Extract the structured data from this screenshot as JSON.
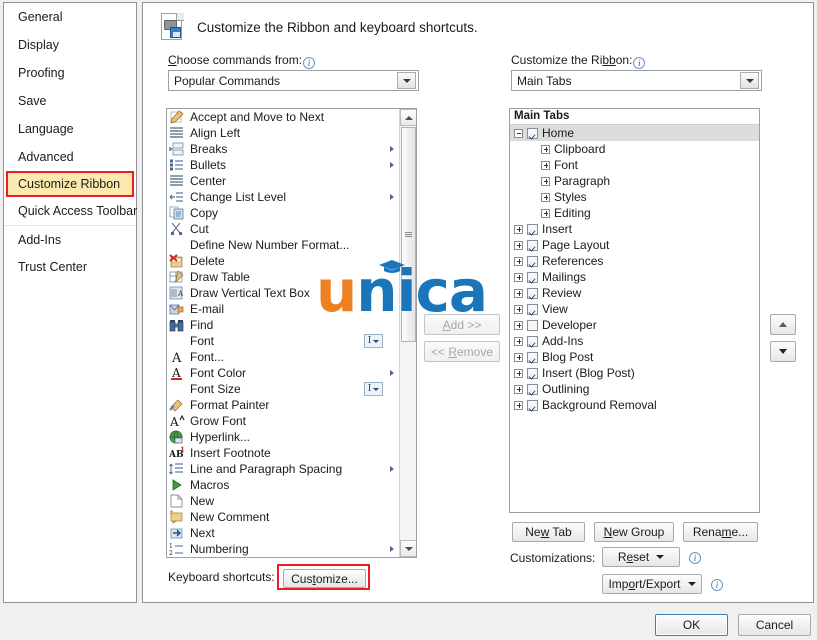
{
  "nav": {
    "items": [
      {
        "label": "General",
        "active": false,
        "sep": false
      },
      {
        "label": "Display",
        "active": false,
        "sep": false
      },
      {
        "label": "Proofing",
        "active": false,
        "sep": false
      },
      {
        "label": "Save",
        "active": false,
        "sep": false
      },
      {
        "label": "Language",
        "active": false,
        "sep": false
      },
      {
        "label": "Advanced",
        "active": false,
        "sep": false
      },
      {
        "label": "Customize Ribbon",
        "active": true,
        "sep": false
      },
      {
        "label": "Quick Access Toolbar",
        "active": false,
        "sep": false
      },
      {
        "label": "Add-Ins",
        "active": false,
        "sep": true
      },
      {
        "label": "Trust Center",
        "active": false,
        "sep": false
      }
    ]
  },
  "header": {
    "title": "Customize the Ribbon and keyboard shortcuts.",
    "icon": "customize-ribbon-icon"
  },
  "left_panel": {
    "label": "Choose commands from:",
    "label_underline": "C",
    "info_icon": "info-icon",
    "dropdown_value": "Popular Commands",
    "commands": [
      {
        "label": "Accept and Move to Next",
        "icon": "accept-changes-icon",
        "submenu": false,
        "widget": null
      },
      {
        "label": "Align Left",
        "icon": "align-left-icon",
        "submenu": false,
        "widget": null
      },
      {
        "label": "Breaks",
        "icon": "breaks-icon",
        "submenu": true,
        "widget": null
      },
      {
        "label": "Bullets",
        "icon": "bullets-icon",
        "submenu": true,
        "widget": null
      },
      {
        "label": "Center",
        "icon": "align-center-icon",
        "submenu": false,
        "widget": null
      },
      {
        "label": "Change List Level",
        "icon": "change-list-level-icon",
        "submenu": true,
        "widget": null
      },
      {
        "label": "Copy",
        "icon": "copy-icon",
        "submenu": false,
        "widget": null
      },
      {
        "label": "Cut",
        "icon": "cut-scissors-icon",
        "submenu": false,
        "widget": null
      },
      {
        "label": "Define New Number Format...",
        "icon": "none",
        "submenu": false,
        "widget": null
      },
      {
        "label": "Delete",
        "icon": "delete-icon",
        "submenu": false,
        "widget": null
      },
      {
        "label": "Draw Table",
        "icon": "draw-table-icon",
        "submenu": false,
        "widget": null
      },
      {
        "label": "Draw Vertical Text Box",
        "icon": "draw-vertical-text-box-icon",
        "submenu": false,
        "widget": null
      },
      {
        "label": "E-mail",
        "icon": "email-icon",
        "submenu": false,
        "widget": null
      },
      {
        "label": "Find",
        "icon": "find-binoculars-icon",
        "submenu": false,
        "widget": null
      },
      {
        "label": "Font",
        "icon": "none",
        "submenu": false,
        "widget": "combo"
      },
      {
        "label": "Font...",
        "icon": "font-a-icon",
        "submenu": false,
        "widget": null
      },
      {
        "label": "Font Color",
        "icon": "font-color-a-icon",
        "submenu": true,
        "widget": null
      },
      {
        "label": "Font Size",
        "icon": "none",
        "submenu": false,
        "widget": "combo"
      },
      {
        "label": "Format Painter",
        "icon": "format-painter-icon",
        "submenu": false,
        "widget": null
      },
      {
        "label": "Grow Font",
        "icon": "grow-font-icon",
        "submenu": false,
        "widget": null
      },
      {
        "label": "Hyperlink...",
        "icon": "hyperlink-globe-icon",
        "submenu": false,
        "widget": null
      },
      {
        "label": "Insert Footnote",
        "icon": "insert-footnote-icon",
        "submenu": false,
        "widget": null
      },
      {
        "label": "Line and Paragraph Spacing",
        "icon": "line-spacing-icon",
        "submenu": true,
        "widget": null
      },
      {
        "label": "Macros",
        "icon": "macros-play-icon",
        "submenu": false,
        "widget": null
      },
      {
        "label": "New",
        "icon": "new-document-icon",
        "submenu": false,
        "widget": null
      },
      {
        "label": "New Comment",
        "icon": "new-comment-icon",
        "submenu": false,
        "widget": null
      },
      {
        "label": "Next",
        "icon": "next-icon",
        "submenu": false,
        "widget": null
      },
      {
        "label": "Numbering",
        "icon": "numbering-icon",
        "submenu": true,
        "widget": null
      }
    ]
  },
  "transfer": {
    "add_label": "Add >>",
    "add_underline": "A",
    "add_enabled": false,
    "remove_label": "<< Remove",
    "remove_underline": "R",
    "remove_enabled": false
  },
  "right_panel": {
    "label": "Customize the Ribbon:",
    "label_underline": "bb",
    "info_icon": "info-icon",
    "dropdown_value": "Main Tabs",
    "tree_header": "Main Tabs",
    "tree": [
      {
        "label": "Home",
        "level": 0,
        "expander": "minus",
        "checkbox": "checked",
        "selected": true
      },
      {
        "label": "Clipboard",
        "level": 1,
        "expander": "plus",
        "checkbox": "none",
        "selected": false
      },
      {
        "label": "Font",
        "level": 1,
        "expander": "plus",
        "checkbox": "none",
        "selected": false
      },
      {
        "label": "Paragraph",
        "level": 1,
        "expander": "plus",
        "checkbox": "none",
        "selected": false
      },
      {
        "label": "Styles",
        "level": 1,
        "expander": "plus",
        "checkbox": "none",
        "selected": false
      },
      {
        "label": "Editing",
        "level": 1,
        "expander": "plus",
        "checkbox": "none",
        "selected": false
      },
      {
        "label": "Insert",
        "level": 0,
        "expander": "plus",
        "checkbox": "checked",
        "selected": false
      },
      {
        "label": "Page Layout",
        "level": 0,
        "expander": "plus",
        "checkbox": "checked",
        "selected": false
      },
      {
        "label": "References",
        "level": 0,
        "expander": "plus",
        "checkbox": "checked",
        "selected": false
      },
      {
        "label": "Mailings",
        "level": 0,
        "expander": "plus",
        "checkbox": "checked",
        "selected": false
      },
      {
        "label": "Review",
        "level": 0,
        "expander": "plus",
        "checkbox": "checked",
        "selected": false
      },
      {
        "label": "View",
        "level": 0,
        "expander": "plus",
        "checkbox": "checked",
        "selected": false
      },
      {
        "label": "Developer",
        "level": 0,
        "expander": "plus",
        "checkbox": "unchecked",
        "selected": false
      },
      {
        "label": "Add-Ins",
        "level": 0,
        "expander": "plus",
        "checkbox": "checked",
        "selected": false
      },
      {
        "label": "Blog Post",
        "level": 0,
        "expander": "plus",
        "checkbox": "checked",
        "selected": false
      },
      {
        "label": "Insert (Blog Post)",
        "level": 0,
        "expander": "plus",
        "checkbox": "checked",
        "selected": false
      },
      {
        "label": "Outlining",
        "level": 0,
        "expander": "plus",
        "checkbox": "checked",
        "selected": false
      },
      {
        "label": "Background Removal",
        "level": 0,
        "expander": "plus",
        "checkbox": "checked",
        "selected": false
      }
    ],
    "move_up_icon": "arrow-up-icon",
    "move_down_icon": "arrow-down-icon",
    "new_tab_label": "New Tab",
    "new_tab_underline": "w",
    "new_group_label": "New Group",
    "new_group_underline": "N",
    "rename_label": "Rename...",
    "rename_underline": "m",
    "customizations_label": "Customizations:",
    "reset_label": "Reset",
    "reset_underline": "e",
    "import_export_label": "Import/Export",
    "import_export_underline": "o"
  },
  "keyboard": {
    "label": "Keyboard shortcuts:",
    "button_label": "Customize...",
    "button_underline": "o",
    "highlight_color": "#ee1c25"
  },
  "footer": {
    "ok_label": "OK",
    "cancel_label": "Cancel"
  },
  "watermark": {
    "part1": "u",
    "part2": "nica",
    "color1": "#ef8022",
    "color2": "#1b75bb",
    "cap_icon": "graduation-cap-icon"
  }
}
